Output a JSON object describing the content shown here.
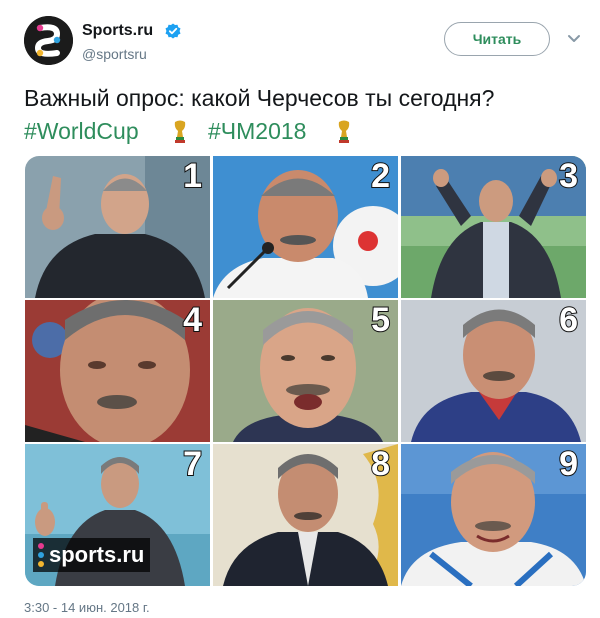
{
  "header": {
    "display_name": "Sports.ru",
    "handle": "@sportsru",
    "follow_label": "Читать",
    "verified": true,
    "accent_color": "#2e8d5c"
  },
  "tweet": {
    "text": "Важный опрос: какой Черчесов ты сегодня?",
    "hashtags": [
      "#WorldCup",
      "#ЧМ2018"
    ],
    "timestamp": "3:30 - 14 июн. 2018 г."
  },
  "photos": [
    {
      "number": "1"
    },
    {
      "number": "2"
    },
    {
      "number": "3"
    },
    {
      "number": "4"
    },
    {
      "number": "5"
    },
    {
      "number": "6"
    },
    {
      "number": "7",
      "watermark": "sports.ru"
    },
    {
      "number": "8"
    },
    {
      "number": "9"
    }
  ],
  "icons": {
    "avatar": "sportsru-logo-icon",
    "verified": "verified-badge-icon",
    "menu": "chevron-down-icon",
    "hashtag_emoji": "world-cup-trophy-icon"
  }
}
